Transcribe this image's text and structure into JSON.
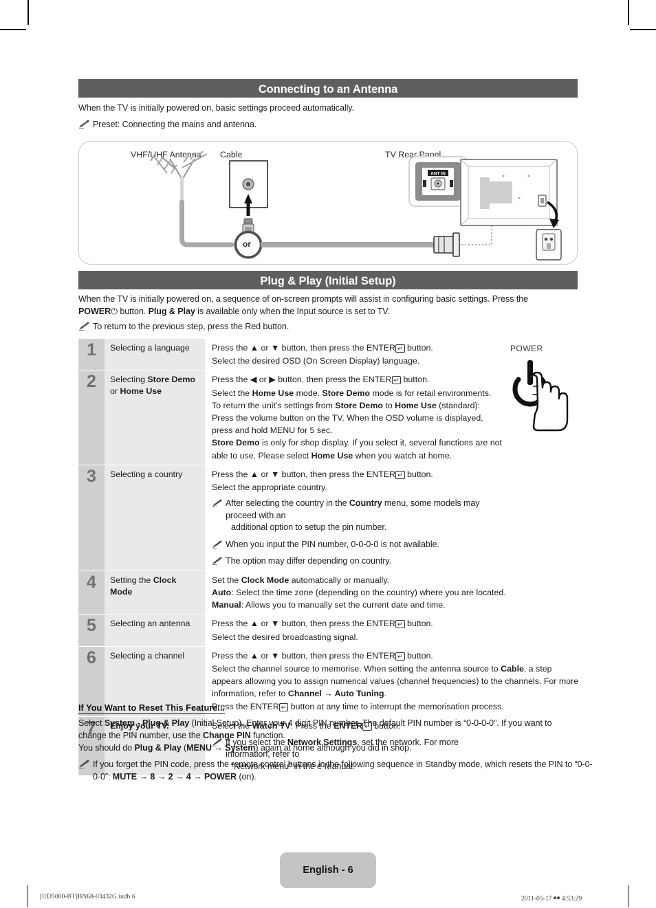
{
  "sections": {
    "antenna": {
      "title": "Connecting to an Antenna",
      "intro": "When the TV is initially powered on, basic settings proceed automatically.",
      "note": "Preset: Connecting the mains and antenna.",
      "diagram": {
        "label_antenna": "VHF/UHF Antenna",
        "label_cable": "Cable",
        "label_tv": "TV Rear Panel",
        "label_or": "or",
        "label_ant_in": "ANT IN"
      }
    },
    "plugplay": {
      "title": "Plug & Play (Initial Setup)",
      "intro_1": "When the TV is initially powered on, a sequence of on-screen prompts will assist in configuring basic settings. Press the",
      "intro_power": "POWER",
      "intro_2": " button. ",
      "intro_pp": "Plug & Play",
      "intro_3": " is available only when the Input source is set to TV.",
      "note": "To return to the previous step, press the Red button.",
      "power_label": "POWER"
    }
  },
  "steps": [
    {
      "num": "1",
      "title_plain_a": "Selecting a language",
      "lines": [
        "Press the ▲ or ▼ button, then press the ENTER↵ button.",
        "Select the desired OSD (On Screen Display) language."
      ]
    },
    {
      "num": "2",
      "title_a": "Selecting ",
      "title_b": "Store Demo",
      "title_c": " or ",
      "title_d": "Home Use",
      "lines": [
        "Press the ◀ or ▶ button, then press the ENTER↵ button.",
        "Select the Home Use mode. Store Demo mode is for retail environments.",
        "To return the unit's settings from Store Demo to Home Use (standard):",
        "Press the volume button on the TV. When the OSD volume is displayed,",
        "press and hold MENU for 5 sec.",
        "Store Demo is only for shop display. If you select it, several functions are not",
        "able to use. Please select Home Use when you watch at home."
      ]
    },
    {
      "num": "3",
      "title_plain_a": "Selecting a country",
      "lines": [
        "Press the ▲ or ▼ button, then press the ENTER↵ button.",
        "Select the appropriate country."
      ],
      "notes": [
        "After selecting the country in the Country menu, some models may proceed with an additional option to setup the pin number.",
        "When you input the PIN number, 0-0-0-0 is not available.",
        "The option may differ depending on country."
      ]
    },
    {
      "num": "4",
      "title_a": "Setting the ",
      "title_b": "Clock Mode",
      "lines": [
        "Set the Clock Mode automatically or manually.",
        "Auto: Select the time zone (depending on the country) where you are located.",
        "Manual: Allows you to manually set the current date and time."
      ]
    },
    {
      "num": "5",
      "title_plain_a": "Selecting an antenna",
      "lines": [
        "Press the ▲ or ▼ button, then press the ENTER↵ button.",
        "Select the desired broadcasting signal."
      ]
    },
    {
      "num": "6",
      "title_plain_a": "Selecting a channel",
      "lines": [
        "Press the ▲ or ▼ button, then press the ENTER↵ button.",
        "Select the channel source to memorise. When setting the antenna source to Cable, a step appears allowing you to assign numerical values (channel frequencies) to the channels. For more information, refer to Channel → Auto Tuning.",
        "Press the ENTER↵ button at any time to interrupt the memorisation process."
      ]
    },
    {
      "num": "7",
      "title_bold": "Enjoy your TV.",
      "lines": [
        "Select the Watch TV. Press the ENTER↵ button."
      ],
      "notes": [
        "If you select the Network Settings, set the network. For more information, refer to “Network menu” in the e-Manual."
      ]
    }
  ],
  "reset": {
    "heading": "If You Want to Reset This Feature...",
    "p1_a": "Select ",
    "p1_system": "System",
    "p1_b": " - ",
    "p1_pp": "Plug & Play",
    "p1_c": " (Initial Setup). Enter your 4 digit PIN number. The default PIN number is “0-0-0-0”. If you want to change the PIN number, use the ",
    "p1_changepin": "Change PIN",
    "p1_d": " function.",
    "p2_a": "You should do ",
    "p2_pp": "Plug & Play",
    "p2_b": " (",
    "p2_menu": "MENU → ",
    "p2_system": "System",
    "p2_c": ") again at home although you did in shop.",
    "note_a": "If you forget the PIN code, press the remote control buttons in the following sequence in Standby mode, which resets the PIN to “0-0-0-0”: ",
    "note_seq": "MUTE → 8 → 2 → 4 → POWER",
    "note_b": " (on)."
  },
  "footer": {
    "page_label": "English - 6",
    "file_ref": "[UD5000-BT]BN68-03432G.indb   6",
    "timestamp": "2011-05-17   ￭￭ 4:53:29"
  },
  "colors": {
    "section_bar": "#5f5f5f",
    "step_number_bg": "#cfcfcf",
    "step_title_bg": "#e9e9e9",
    "page_badge_bg": "#c4c4c4"
  }
}
